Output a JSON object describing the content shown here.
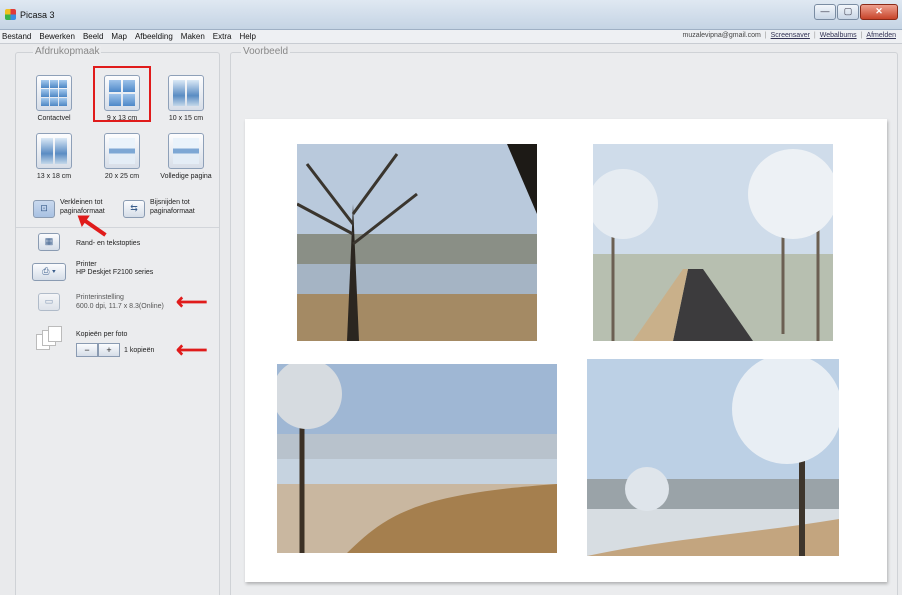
{
  "window": {
    "title": "Picasa 3",
    "close_label": "✕",
    "min_label": "—",
    "max_label": "▢"
  },
  "menu": [
    "Bestand",
    "Bewerken",
    "Beeld",
    "Map",
    "Afbeelding",
    "Maken",
    "Extra",
    "Help"
  ],
  "account": {
    "email": "muzalevipna@gmail.com",
    "links": [
      "Screensaver",
      "Webalbums",
      "Afmelden"
    ]
  },
  "left_panel": {
    "title": "Afdrukopmaak",
    "layouts": [
      {
        "label": "Contactvel",
        "selected": false
      },
      {
        "label": "9 x 13 cm",
        "selected": true
      },
      {
        "label": "10 x 15 cm",
        "selected": false
      },
      {
        "label": "13 x 18 cm",
        "selected": false
      },
      {
        "label": "20 x 25 cm",
        "selected": false
      },
      {
        "label": "Volledige pagina",
        "selected": false
      }
    ],
    "scale": {
      "shrink_line1": "Verkleinen tot",
      "shrink_line2": "paginaformaat",
      "crop_line1": "Bijsnijden tot",
      "crop_line2": "paginaformaat"
    },
    "border_text": "Rand- en tekstopties",
    "printer_label": "Printer",
    "printer_name": "HP Deskjet F2100 series",
    "printer_settings_label": "Printerinstelling",
    "printer_settings_value": "600.0 dpi, 11.7 x 8.3(Online)",
    "copies_label": "Kopieën per foto",
    "copies_minus": "−",
    "copies_plus": "+",
    "copies_value": "1 kopieën"
  },
  "preview": {
    "title": "Voorbeeld"
  },
  "colors": {
    "highlight": "#e01b1b"
  }
}
